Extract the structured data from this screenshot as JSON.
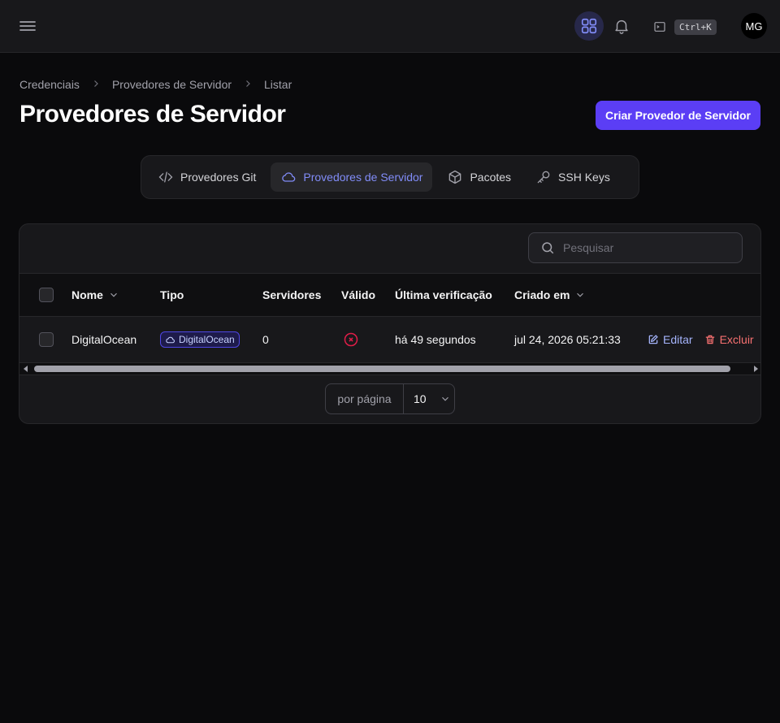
{
  "topbar": {
    "menu_icon": "hamburger-menu-icon",
    "apps_icon": "grid-apps-icon",
    "bell_icon": "bell-icon",
    "terminal_icon": "terminal-icon",
    "shortcut": "Ctrl+K",
    "avatar_initials": "MG"
  },
  "breadcrumb": [
    "Credenciais",
    "Provedores de Servidor",
    "Listar"
  ],
  "page": {
    "title": "Provedores de Servidor",
    "create_button": "Criar Provedor de Servidor"
  },
  "tabs": [
    {
      "label": "Provedores Git",
      "icon": "code-icon",
      "active": false
    },
    {
      "label": "Provedores de Servidor",
      "icon": "cloud-icon",
      "active": true
    },
    {
      "label": "Pacotes",
      "icon": "package-icon",
      "active": false
    },
    {
      "label": "SSH Keys",
      "icon": "key-icon",
      "active": false
    }
  ],
  "search": {
    "placeholder": "Pesquisar"
  },
  "table": {
    "headers": {
      "name": "Nome",
      "type": "Tipo",
      "servers": "Servidores",
      "valid": "Válido",
      "last_check": "Última verificação",
      "created": "Criado em"
    },
    "rows": [
      {
        "name": "DigitalOcean",
        "type": "DigitalOcean",
        "servers": "0",
        "valid": false,
        "last_check": "há 49 segundos",
        "created": "jul 24, 2026 05:21:33",
        "edit": "Editar",
        "delete": "Excluir"
      }
    ]
  },
  "pagination": {
    "label": "por página",
    "per_page": "10"
  },
  "colors": {
    "accent": "#5b3ef5",
    "active_tab_text": "#818cf8",
    "danger": "#f87171",
    "invalid_icon": "#e11d48"
  }
}
